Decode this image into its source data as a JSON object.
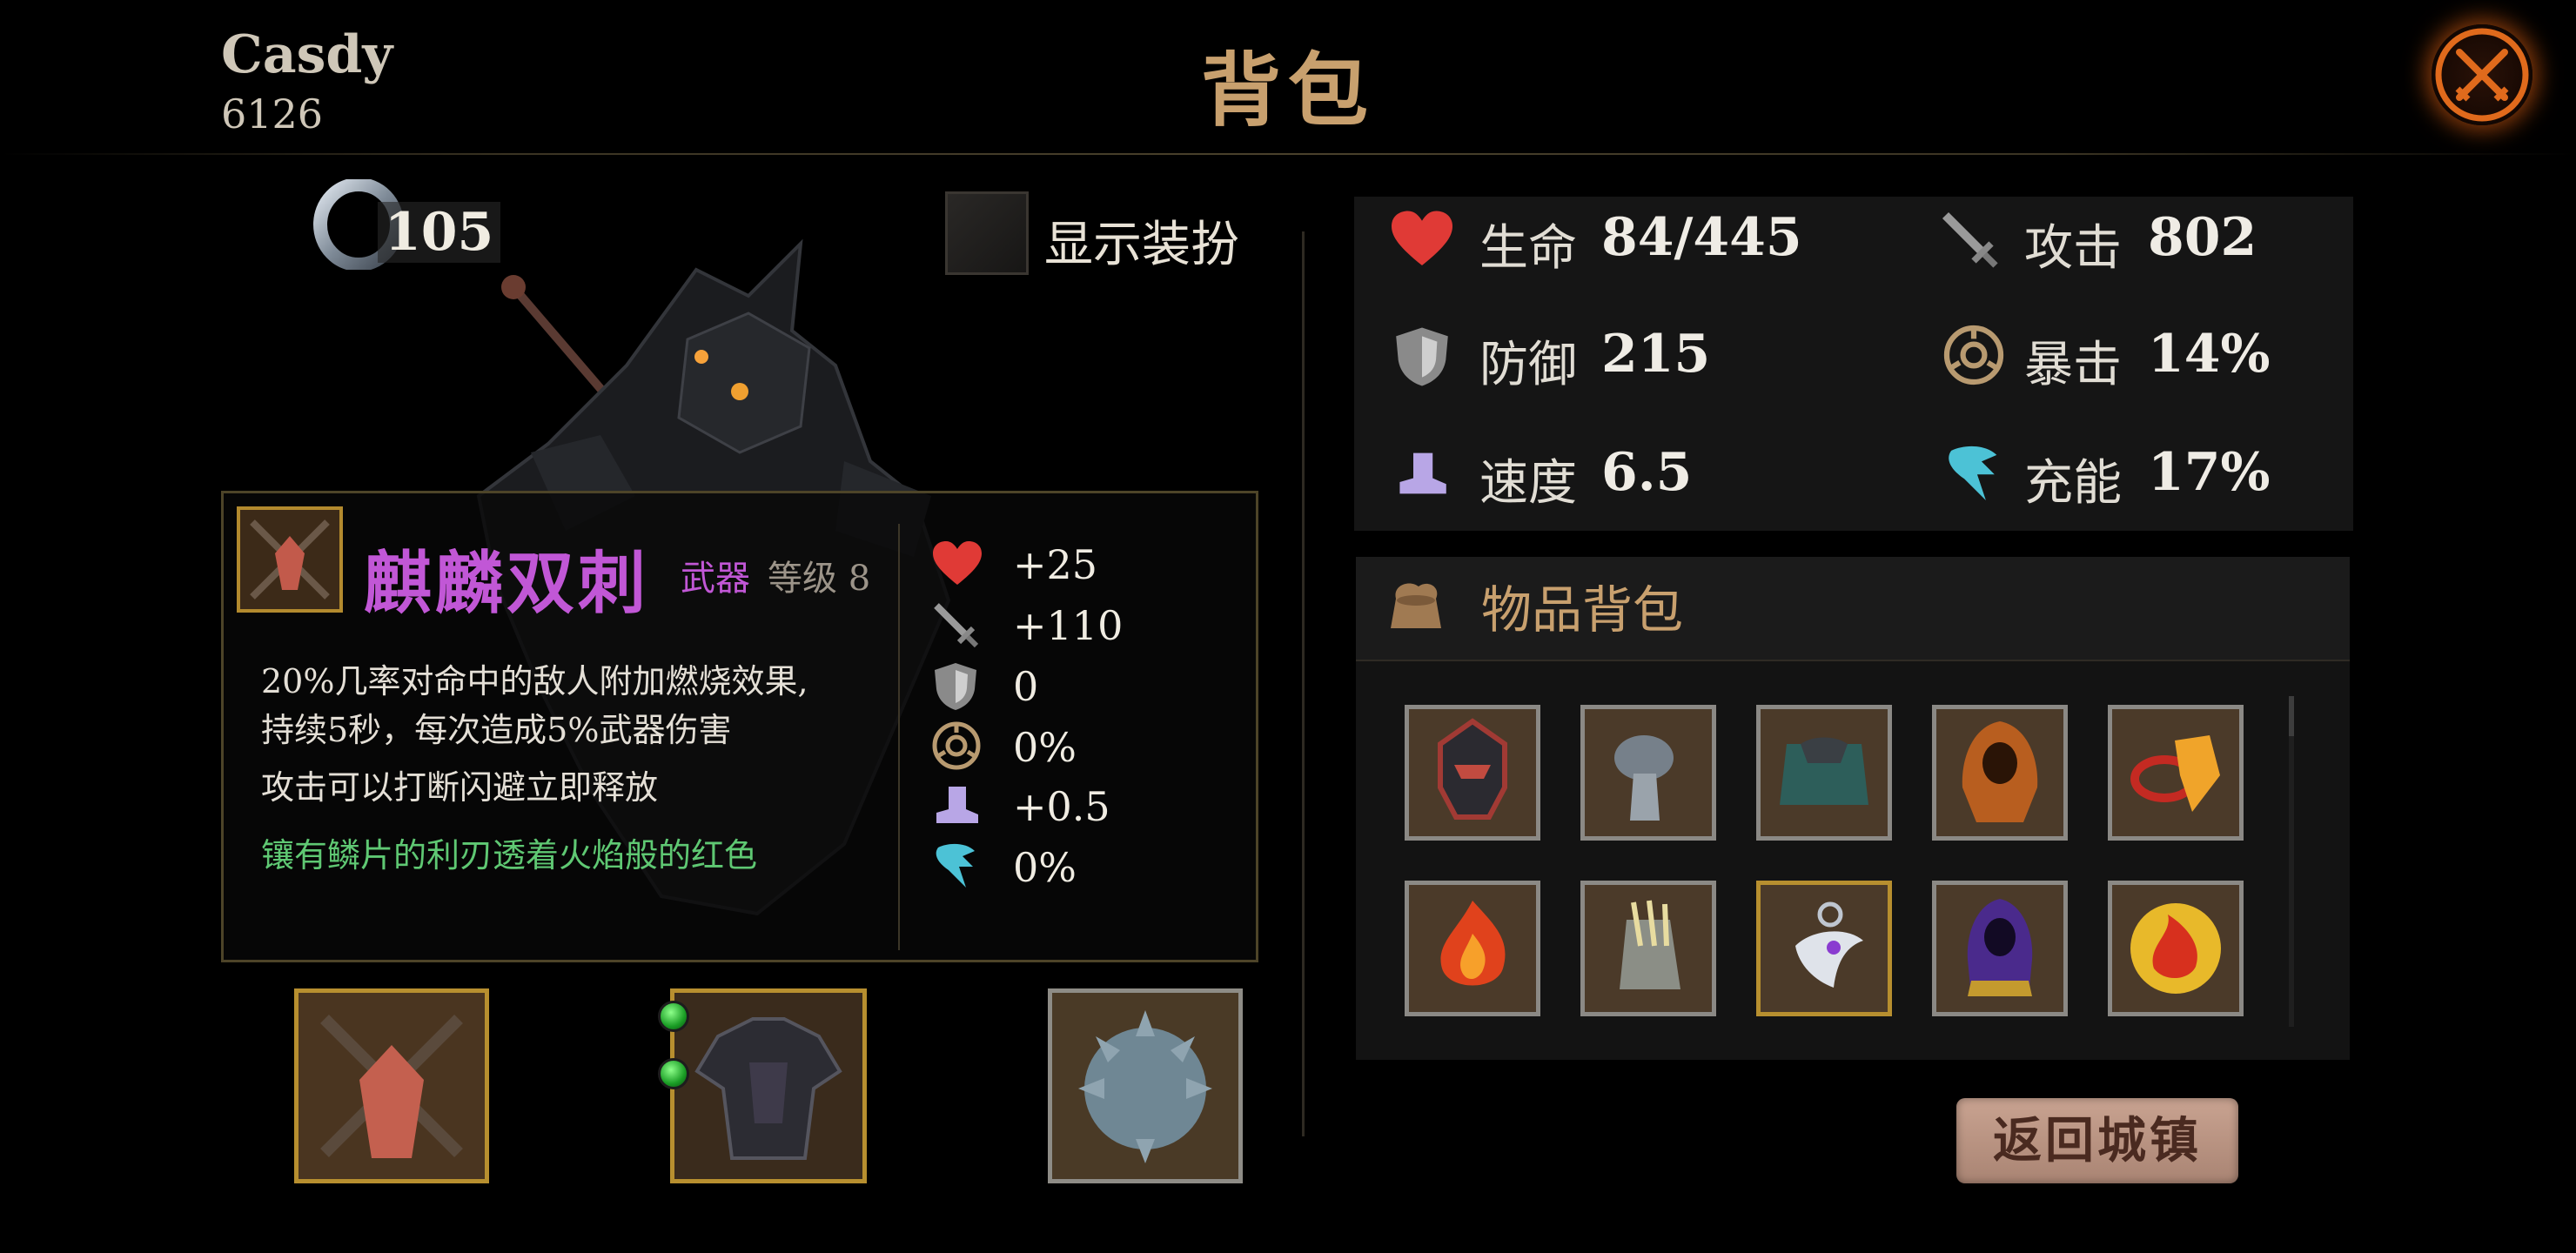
{
  "header": {
    "player_name": "Casdy",
    "player_id": "6126",
    "title": "背包"
  },
  "currency": {
    "ring_count": "105"
  },
  "display": {
    "show_outfit_label": "显示装扮"
  },
  "item_detail": {
    "name": "麒麟双刺",
    "type": "武器",
    "level": "等级 8",
    "desc_line1": "20%几率对命中的敌人附加燃烧效果,",
    "desc_line2": "持续5秒，每次造成5%武器伤害",
    "desc_line3": "攻击可以打断闪避立即释放",
    "flavor": "镶有鳞片的利刃透着火焰般的红色",
    "stats": [
      {
        "icon": "heart-icon",
        "value": "+25"
      },
      {
        "icon": "sword-icon",
        "value": "+110"
      },
      {
        "icon": "shield-icon",
        "value": "0"
      },
      {
        "icon": "crit-icon",
        "value": "0%"
      },
      {
        "icon": "boot-icon",
        "value": "+0.5"
      },
      {
        "icon": "charge-icon",
        "value": "0%"
      }
    ]
  },
  "character_stats": {
    "hp_label": "生命",
    "hp_value": "84/445",
    "attack_label": "攻击",
    "attack_value": "802",
    "defense_label": "防御",
    "defense_value": "215",
    "crit_label": "暴击",
    "crit_value": "14%",
    "speed_label": "速度",
    "speed_value": "6.5",
    "charge_label": "充能",
    "charge_value": "17%"
  },
  "inventory": {
    "title": "物品背包",
    "items": [
      {
        "icon": "dark-helmet-icon",
        "frame": "silver"
      },
      {
        "icon": "gauntlet-icon",
        "frame": "silver"
      },
      {
        "icon": "cape-icon",
        "frame": "silver"
      },
      {
        "icon": "hood-icon",
        "frame": "silver"
      },
      {
        "icon": "fire-ring-icon",
        "frame": "silver"
      },
      {
        "icon": "flame-gem-icon",
        "frame": "silver"
      },
      {
        "icon": "claw-gauntlet-icon",
        "frame": "silver"
      },
      {
        "icon": "moon-pendant-icon",
        "frame": "gold"
      },
      {
        "icon": "purple-robe-icon",
        "frame": "silver"
      },
      {
        "icon": "fire-orb-icon",
        "frame": "silver"
      }
    ]
  },
  "actions": {
    "return_town": "返回城镇"
  },
  "colors": {
    "title": "#c8a06e",
    "item_name": "#c157d6",
    "flavor_text": "#5fc873",
    "gold_frame": "#b78f2f",
    "silver_frame": "#8b8985"
  }
}
